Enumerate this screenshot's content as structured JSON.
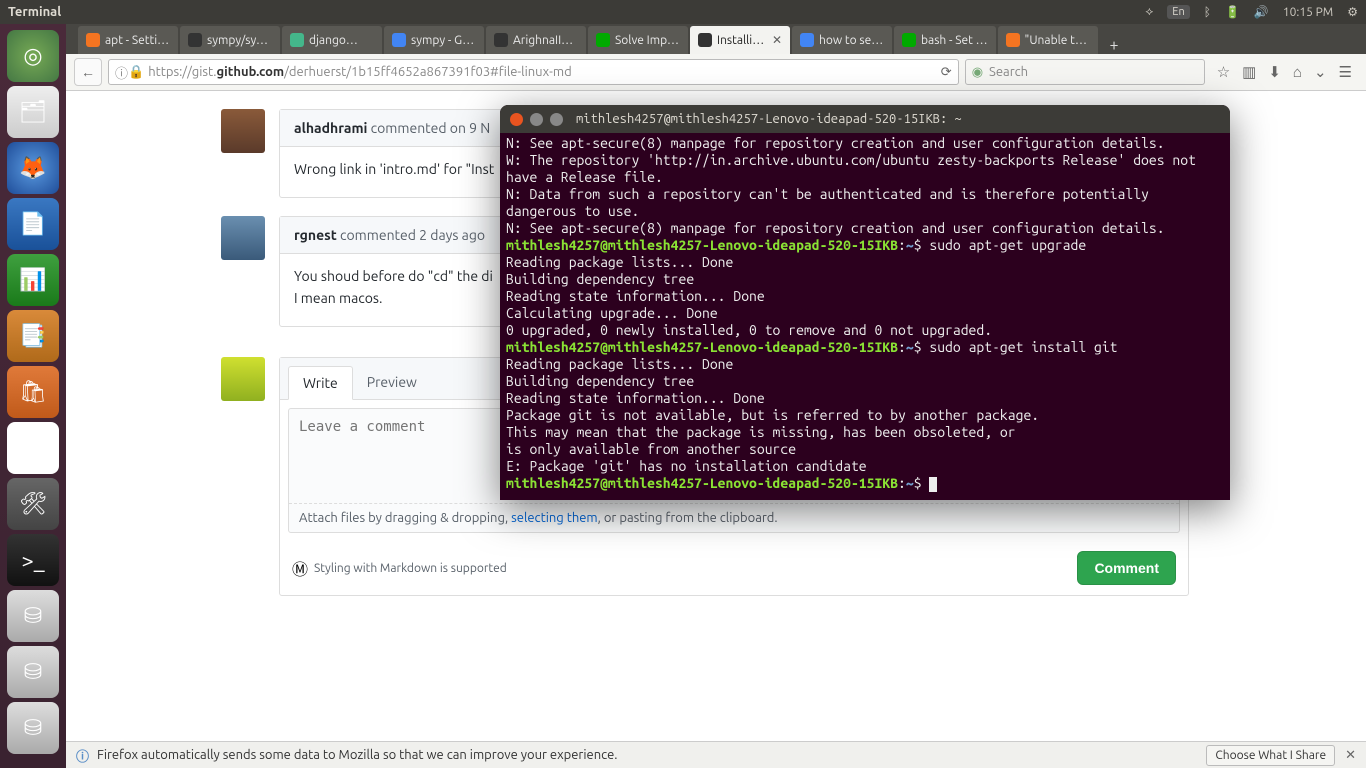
{
  "menubar": {
    "title": "Terminal",
    "lang": "En",
    "time": "10:15 PM"
  },
  "launcher": [
    {
      "name": "dash-icon",
      "cls": "dash",
      "glyph": "◎"
    },
    {
      "name": "files-app",
      "cls": "files",
      "glyph": "🗂"
    },
    {
      "name": "firefox-app",
      "cls": "fx",
      "glyph": "🦊"
    },
    {
      "name": "writer-app",
      "cls": "writer",
      "glyph": "📄"
    },
    {
      "name": "calc-app",
      "cls": "calc",
      "glyph": "📊"
    },
    {
      "name": "impress-app",
      "cls": "impress",
      "glyph": "📑"
    },
    {
      "name": "software-center",
      "cls": "usc",
      "glyph": "🛍"
    },
    {
      "name": "amazon-app",
      "cls": "amz",
      "glyph": "a"
    },
    {
      "name": "settings-app",
      "cls": "settings",
      "glyph": "🛠"
    },
    {
      "name": "terminal-app",
      "cls": "term",
      "glyph": ">_"
    },
    {
      "name": "disk1",
      "cls": "disk",
      "glyph": "⛁"
    },
    {
      "name": "disk2",
      "cls": "disk",
      "glyph": "⛁"
    },
    {
      "name": "disk3",
      "cls": "disk",
      "glyph": "⛁"
    }
  ],
  "tabs": [
    {
      "label": "apt - Setti…",
      "fav": "#f47421"
    },
    {
      "label": "sympy/sy…",
      "fav": "#333"
    },
    {
      "label": "django…",
      "fav": "#44b78b"
    },
    {
      "label": "sympy - G…",
      "fav": "#4285f4"
    },
    {
      "label": "ArighnaII…",
      "fav": "#333"
    },
    {
      "label": "Solve Imp…",
      "fav": "#0a0"
    },
    {
      "label": "Installi…",
      "fav": "#333",
      "active": true
    },
    {
      "label": "how to se…",
      "fav": "#4285f4"
    },
    {
      "label": "bash - Set …",
      "fav": "#0a0"
    },
    {
      "label": "\"Unable t…",
      "fav": "#f47421"
    }
  ],
  "url": {
    "scheme": "https://gist.",
    "host": "github.com",
    "path": "/derhuerst/1b15ff4652a867391f03#file-linux-md"
  },
  "search_placeholder": "Search",
  "comments": [
    {
      "user": "alhadhrami",
      "meta": "commented on 9 N",
      "body": [
        "Wrong link in 'intro.md' for \"Inst"
      ],
      "av": "av1"
    },
    {
      "user": "rgnest",
      "meta": "commented 2 days ago",
      "body": [
        "You shoud before do \"cd\" the di",
        "I mean macos."
      ],
      "av": "av2"
    }
  ],
  "compose": {
    "write": "Write",
    "preview": "Preview",
    "placeholder": "Leave a comment",
    "attach_pre": "Attach files by dragging & dropping, ",
    "attach_link": "selecting them",
    "attach_post": ", or pasting from the clipboard.",
    "md_hint": "Styling with Markdown is supported",
    "button": "Comment"
  },
  "notif": {
    "text": "Firefox automatically sends some data to Mozilla so that we can improve your experience.",
    "choose": "Choose What I Share"
  },
  "terminal": {
    "title": "mithlesh4257@mithlesh4257-Lenovo-ideapad-520-15IKB: ~",
    "prompt_user": "mithlesh4257@mithlesh4257-Lenovo-ideapad-520-15IKB",
    "prompt_path": "~",
    "lines": [
      {
        "t": "N: See apt-secure(8) manpage for repository creation and user configuration details."
      },
      {
        "t": "W: The repository 'http://in.archive.ubuntu.com/ubuntu zesty-backports Release' does not have a Release file."
      },
      {
        "t": "N: Data from such a repository can't be authenticated and is therefore potentially dangerous to use."
      },
      {
        "t": "N: See apt-secure(8) manpage for repository creation and user configuration details."
      },
      {
        "prompt": true,
        "cmd": "sudo apt-get upgrade"
      },
      {
        "t": "Reading package lists... Done"
      },
      {
        "t": "Building dependency tree"
      },
      {
        "t": "Reading state information... Done"
      },
      {
        "t": "Calculating upgrade... Done"
      },
      {
        "t": "0 upgraded, 0 newly installed, 0 to remove and 0 not upgraded."
      },
      {
        "prompt": true,
        "cmd": "sudo apt-get install git"
      },
      {
        "t": "Reading package lists... Done"
      },
      {
        "t": "Building dependency tree"
      },
      {
        "t": "Reading state information... Done"
      },
      {
        "t": "Package git is not available, but is referred to by another package."
      },
      {
        "t": "This may mean that the package is missing, has been obsoleted, or"
      },
      {
        "t": "is only available from another source"
      },
      {
        "t": ""
      },
      {
        "t": "E: Package 'git' has no installation candidate"
      },
      {
        "prompt": true,
        "cmd": "",
        "cursor": true
      }
    ]
  }
}
